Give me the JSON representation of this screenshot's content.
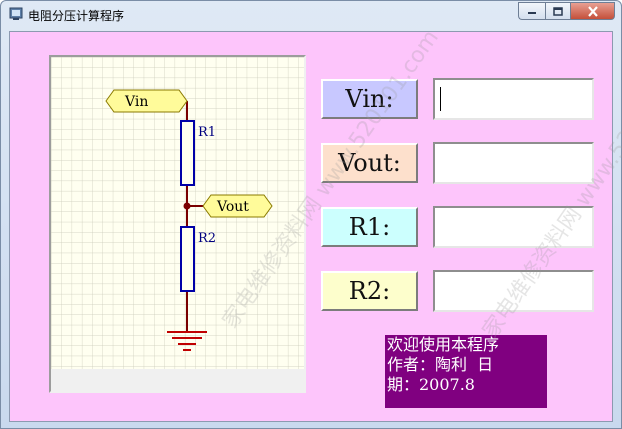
{
  "window": {
    "title": "电阻分压计算程序",
    "controls": [
      "minimize",
      "maximize",
      "close"
    ]
  },
  "colors": {
    "client_bg": "#fdc5fb",
    "vin_btn": "#c8c8ff",
    "vout_btn": "#fde0cc",
    "r1_btn": "#ccfffe",
    "r2_btn": "#fdfecc",
    "info_bg": "#800080",
    "tag_fill": "#fffb9a"
  },
  "schematic": {
    "tags": {
      "vin": "Vin",
      "vout": "Vout"
    },
    "labels": {
      "r1": "R1",
      "r2": "R2"
    }
  },
  "form": {
    "vin_label": "Vin:",
    "vout_label": "Vout:",
    "r1_label": "R1:",
    "r2_label": "R2:",
    "vin_value": "",
    "vout_value": "",
    "r1_value": "",
    "r2_value": ""
  },
  "info": {
    "line1": "欢迎使用本程序",
    "line2": "作者：陶利  日",
    "line3": "期：2007.8"
  },
  "watermark_text": "家电维修资料网 www.520101.com"
}
